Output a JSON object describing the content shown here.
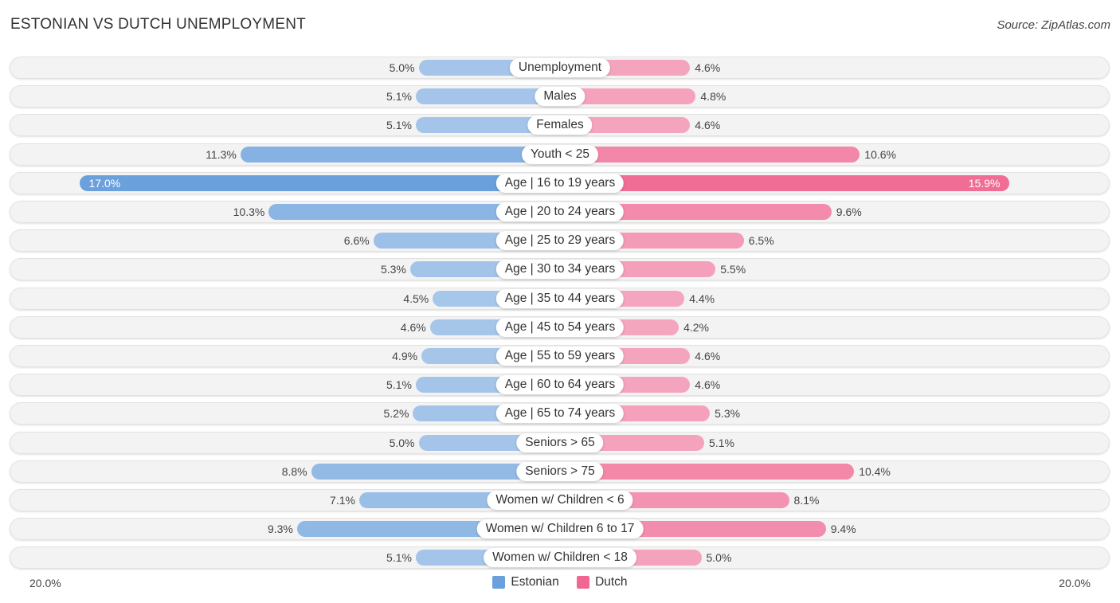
{
  "header": {
    "title": "ESTONIAN VS DUTCH UNEMPLOYMENT",
    "source": "Source: ZipAtlas.com"
  },
  "colors": {
    "estonian": "#6aa1dd",
    "estonian_light": "#a9c8ea",
    "dutch": "#f06892",
    "dutch_light": "#f5a7c0",
    "row_background": "#f3f3f3"
  },
  "chart_data": {
    "type": "bar",
    "orientation": "horizontal-diverging",
    "title": "ESTONIAN VS DUTCH UNEMPLOYMENT",
    "xlabel": "",
    "ylabel": "",
    "xlim": [
      -20.0,
      20.0
    ],
    "axis_labels": {
      "left": "20.0%",
      "right": "20.0%"
    },
    "legend": {
      "position": "bottom-center",
      "entries": [
        "Estonian",
        "Dutch"
      ]
    },
    "categories": [
      "Unemployment",
      "Males",
      "Females",
      "Youth < 25",
      "Age | 16 to 19 years",
      "Age | 20 to 24 years",
      "Age | 25 to 29 years",
      "Age | 30 to 34 years",
      "Age | 35 to 44 years",
      "Age | 45 to 54 years",
      "Age | 55 to 59 years",
      "Age | 60 to 64 years",
      "Age | 65 to 74 years",
      "Seniors > 65",
      "Seniors > 75",
      "Women w/ Children < 6",
      "Women w/ Children 6 to 17",
      "Women w/ Children < 18"
    ],
    "series": [
      {
        "name": "Estonian",
        "side": "left",
        "values": [
          5.0,
          5.1,
          5.1,
          11.3,
          17.0,
          10.3,
          6.6,
          5.3,
          4.5,
          4.6,
          4.9,
          5.1,
          5.2,
          5.0,
          8.8,
          7.1,
          9.3,
          5.1
        ],
        "labels": [
          "5.0%",
          "5.1%",
          "5.1%",
          "11.3%",
          "17.0%",
          "10.3%",
          "6.6%",
          "5.3%",
          "4.5%",
          "4.6%",
          "4.9%",
          "5.1%",
          "5.2%",
          "5.0%",
          "8.8%",
          "7.1%",
          "9.3%",
          "5.1%"
        ]
      },
      {
        "name": "Dutch",
        "side": "right",
        "values": [
          4.6,
          4.8,
          4.6,
          10.6,
          15.9,
          9.6,
          6.5,
          5.5,
          4.4,
          4.2,
          4.6,
          4.6,
          5.3,
          5.1,
          10.4,
          8.1,
          9.4,
          5.0
        ],
        "labels": [
          "4.6%",
          "4.8%",
          "4.6%",
          "10.6%",
          "15.9%",
          "9.6%",
          "6.5%",
          "5.5%",
          "4.4%",
          "4.2%",
          "4.6%",
          "4.6%",
          "5.3%",
          "5.1%",
          "10.4%",
          "8.1%",
          "9.4%",
          "5.0%"
        ]
      }
    ],
    "grid": false
  }
}
